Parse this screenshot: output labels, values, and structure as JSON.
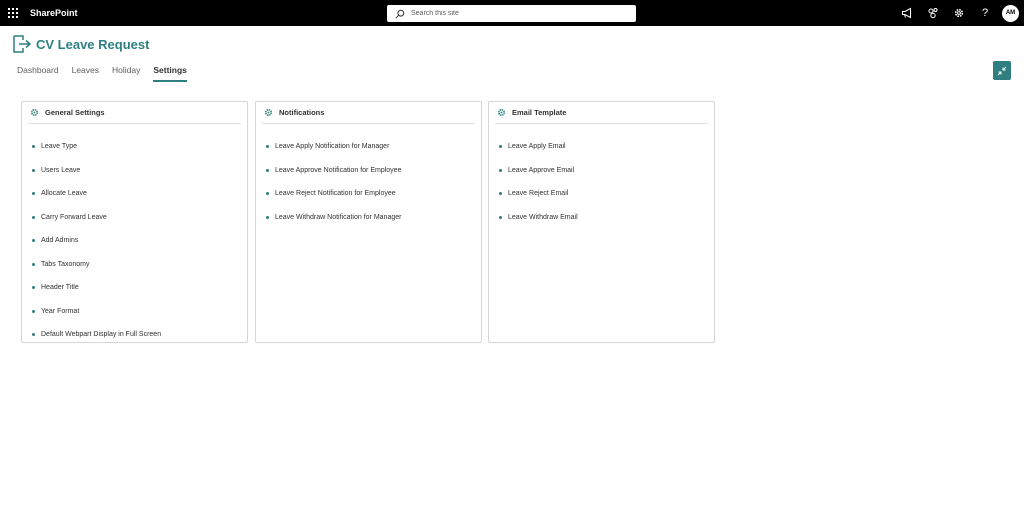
{
  "suitebar": {
    "brand": "SharePoint",
    "search_placeholder": "Search this site",
    "avatar_initials": "AM",
    "help_label": "?"
  },
  "app": {
    "title": "CV Leave Request"
  },
  "tabs": [
    {
      "label": "Dashboard",
      "active": false
    },
    {
      "label": "Leaves",
      "active": false
    },
    {
      "label": "Holiday",
      "active": false
    },
    {
      "label": "Settings",
      "active": true
    }
  ],
  "colors": {
    "accent": "#2f7f80",
    "suitebar": "#000000"
  },
  "cards": [
    {
      "title": "General Settings",
      "icon": "gear-icon",
      "items": [
        "Leave Type",
        "Users Leave",
        "Allocate Leave",
        "Carry Forward Leave",
        "Add Admins",
        "Tabs Taxonomy",
        "Header Title",
        "Year Format",
        "Default Webpart Display in Full Screen"
      ]
    },
    {
      "title": "Notifications",
      "icon": "gear-icon",
      "items": [
        "Leave Apply Notification for Manager",
        "Leave Approve Notification for Employee",
        "Leave Reject Notification for Employee",
        "Leave Withdraw Notification for Manager"
      ]
    },
    {
      "title": "Email Template",
      "icon": "gear-icon",
      "items": [
        "Leave Apply Email",
        "Leave Approve Email",
        "Leave Reject Email",
        "Leave Withdraw Email"
      ]
    }
  ]
}
